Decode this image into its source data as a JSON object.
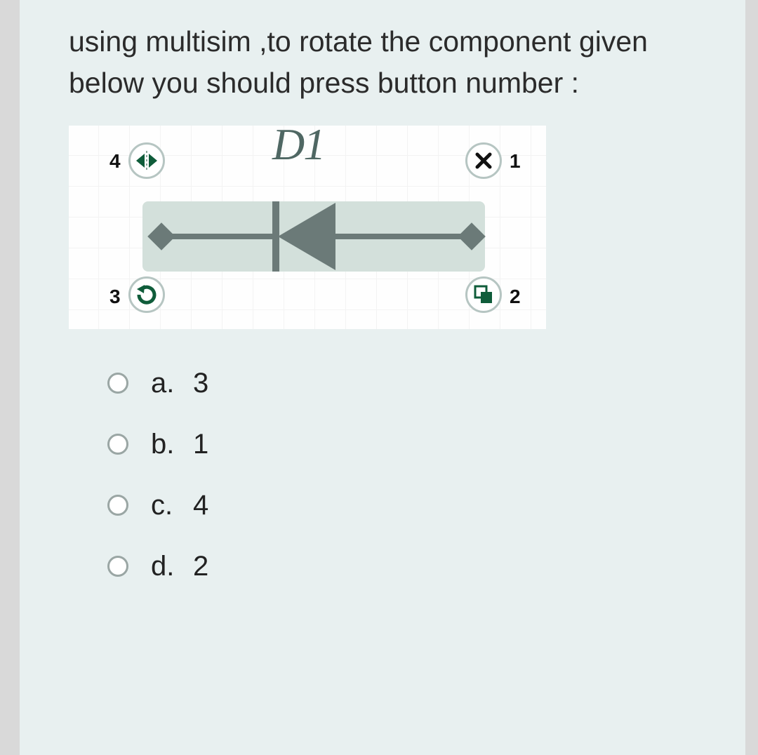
{
  "question": {
    "prompt": "using multisim ,to rotate the component given below you should press button number :"
  },
  "diagram": {
    "component_label": "D1",
    "handles": {
      "top_left": {
        "num": "4"
      },
      "top_right": {
        "num": "1"
      },
      "bottom_left": {
        "num": "3"
      },
      "bottom_right": {
        "num": "2"
      }
    }
  },
  "choices": [
    {
      "letter": "a.",
      "text": "3"
    },
    {
      "letter": "b.",
      "text": "1"
    },
    {
      "letter": "c.",
      "text": "4"
    },
    {
      "letter": "d.",
      "text": "2"
    }
  ]
}
